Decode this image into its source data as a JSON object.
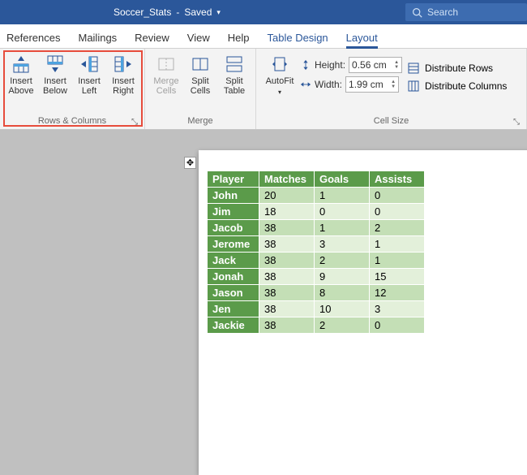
{
  "title": {
    "filename": "Soccer_Stats",
    "status": "Saved"
  },
  "search": {
    "placeholder": "Search"
  },
  "tabs": [
    "References",
    "Mailings",
    "Review",
    "View",
    "Help",
    "Table Design",
    "Layout"
  ],
  "ribbon": {
    "rows_columns": {
      "label": "Rows & Columns",
      "insert_above": "Insert\nAbove",
      "insert_below": "Insert\nBelow",
      "insert_left": "Insert\nLeft",
      "insert_right": "Insert\nRight"
    },
    "merge": {
      "label": "Merge",
      "merge_cells": "Merge\nCells",
      "split_cells": "Split\nCells",
      "split_table": "Split\nTable"
    },
    "autofit": {
      "label": "AutoFit"
    },
    "cellsize": {
      "label": "Cell Size",
      "height_label": "Height:",
      "width_label": "Width:",
      "height": "0.56 cm",
      "width": "1.99 cm",
      "dist_rows": "Distribute Rows",
      "dist_cols": "Distribute Columns"
    }
  },
  "table": {
    "headers": [
      "Player",
      "Matches",
      "Goals",
      "Assists"
    ],
    "rows": [
      {
        "name": "John",
        "matches": 20,
        "goals": 1,
        "assists": 0
      },
      {
        "name": "Jim",
        "matches": 18,
        "goals": 0,
        "assists": 0
      },
      {
        "name": "Jacob",
        "matches": 38,
        "goals": 1,
        "assists": 2
      },
      {
        "name": "Jerome",
        "matches": 38,
        "goals": 3,
        "assists": 1
      },
      {
        "name": "Jack",
        "matches": 38,
        "goals": 2,
        "assists": 1
      },
      {
        "name": "Jonah",
        "matches": 38,
        "goals": 9,
        "assists": 15
      },
      {
        "name": "Jason",
        "matches": 38,
        "goals": 8,
        "assists": 12
      },
      {
        "name": "Jen",
        "matches": 38,
        "goals": 10,
        "assists": 3
      },
      {
        "name": "Jackie",
        "matches": 38,
        "goals": 2,
        "assists": 0
      }
    ]
  }
}
